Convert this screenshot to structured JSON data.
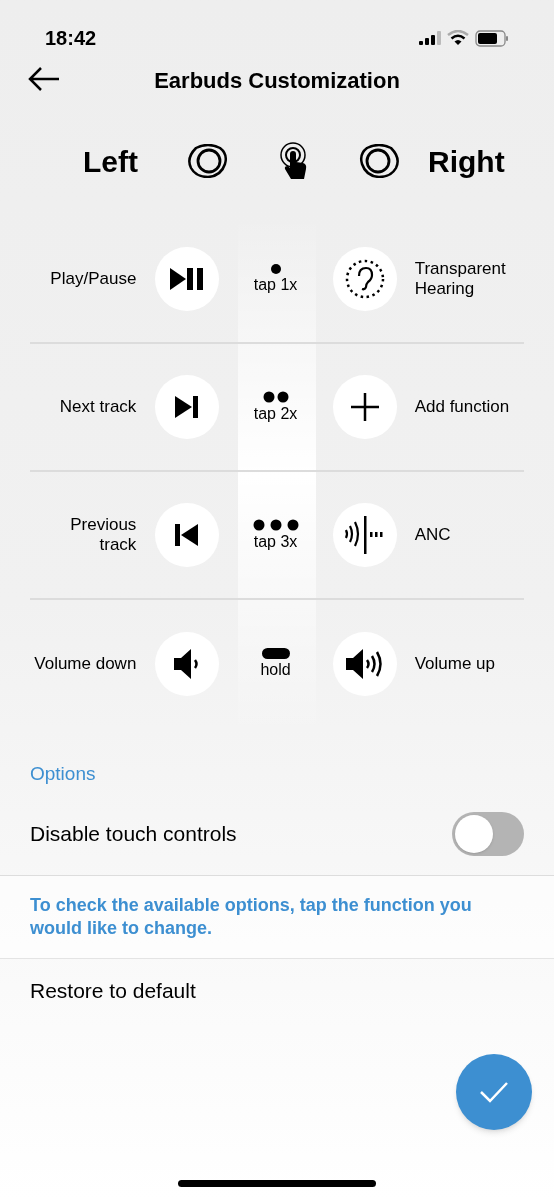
{
  "status_bar": {
    "time": "18:42"
  },
  "header": {
    "title": "Earbuds Customization"
  },
  "columns": {
    "left": "Left",
    "right": "Right"
  },
  "gestures": [
    {
      "left": {
        "label": "Play/Pause",
        "kind": "play_pause"
      },
      "gesture": {
        "label": "tap 1x",
        "kind": "tap1"
      },
      "right": {
        "label": "Transparent Hearing",
        "kind": "ear"
      }
    },
    {
      "left": {
        "label": "Next track",
        "kind": "next"
      },
      "gesture": {
        "label": "tap 2x",
        "kind": "tap2"
      },
      "right": {
        "label": "Add function",
        "kind": "plus"
      }
    },
    {
      "left": {
        "label": "Previous track",
        "kind": "previous"
      },
      "gesture": {
        "label": "tap 3x",
        "kind": "tap3"
      },
      "right": {
        "label": "ANC",
        "kind": "anc"
      }
    },
    {
      "left": {
        "label": "Volume down",
        "kind": "volume_down"
      },
      "gesture": {
        "label": "hold",
        "kind": "hold"
      },
      "right": {
        "label": "Volume up",
        "kind": "volume_up"
      }
    }
  ],
  "options": {
    "heading": "Options",
    "toggle": {
      "label": "Disable touch controls",
      "on": false
    },
    "hint": "To check the available options, tap the function you would like to change.",
    "restore": "Restore to default"
  }
}
